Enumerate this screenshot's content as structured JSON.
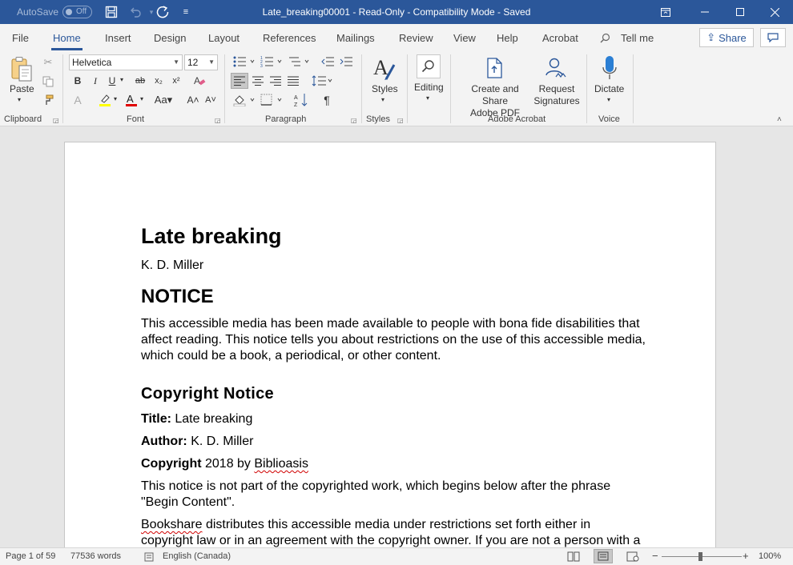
{
  "titlebar": {
    "autosave_label": "AutoSave",
    "autosave_state": "Off",
    "title": "Late_breaking00001  -  Read-Only  -  Compatibility Mode  -  Saved",
    "accent": "#2b579a"
  },
  "tabs": [
    "File",
    "Home",
    "Insert",
    "Design",
    "Layout",
    "References",
    "Mailings",
    "Review",
    "View",
    "Help",
    "Acrobat"
  ],
  "active_tab": "Home",
  "tell_me": "Tell me",
  "share_label": "Share",
  "ribbon": {
    "clipboard": {
      "paste": "Paste",
      "label": "Clipboard"
    },
    "font": {
      "name": "Helvetica",
      "size": "12",
      "label": "Font"
    },
    "paragraph": {
      "label": "Paragraph"
    },
    "styles": {
      "button": "Styles",
      "label": "Styles"
    },
    "editing": {
      "button": "Editing"
    },
    "acrobat": {
      "create_line1": "Create and Share",
      "create_line2": "Adobe PDF",
      "request_line1": "Request",
      "request_line2": "Signatures",
      "label": "Adobe Acrobat"
    },
    "voice": {
      "button": "Dictate",
      "label": "Voice"
    }
  },
  "document": {
    "title": "Late breaking",
    "author": "K. D. Miller",
    "notice_heading": "NOTICE",
    "notice_text": "This accessible media has been made available to people with bona fide disabilities that affect reading. This notice tells you about restrictions on the use of this accessible media, which could be a book, a periodical, or other content.",
    "copyright_heading": "Copyright Notice",
    "title_label": "Title:",
    "title_value": " Late breaking",
    "author_label": "Author:",
    "author_value": " K. D. Miller",
    "copyright_label": "Copyright",
    "copyright_value": " 2018 by ",
    "publisher": "Biblioasis",
    "notice_note": "This notice is not part of the copyrighted work, which begins below after the phrase \"Begin Content\".",
    "bookshare": "Bookshare",
    "bookshare_text": " distributes this accessible media under restrictions set forth either in copyright law or in an agreement with the copyright owner. If you are not a person with a print disability, or an agency serving people with print disabilities, you should not use"
  },
  "status": {
    "page": "Page 1 of 59",
    "words": "77536 words",
    "language": "English (Canada)",
    "zoom": "100%"
  }
}
